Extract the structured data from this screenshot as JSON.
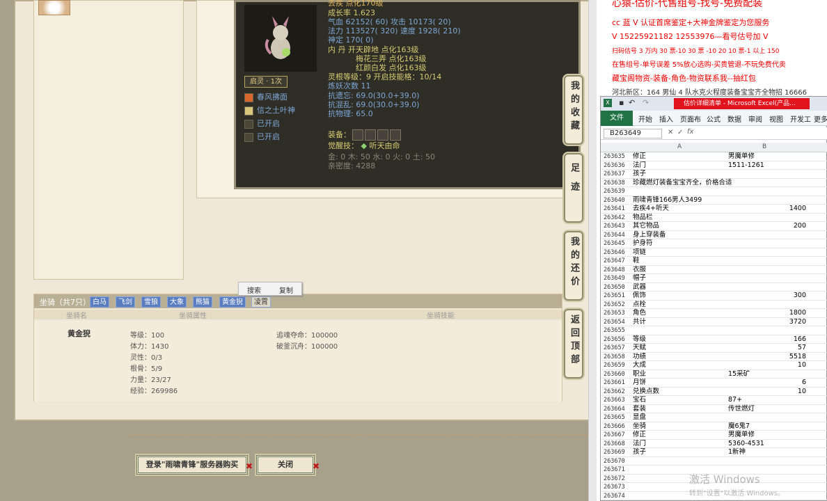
{
  "pet": {
    "line0": "去疾 点化170级",
    "growth": "成长率 1.623",
    "qixue": "气血 62152( 60) 攻击 10173( 20)",
    "fali": "法力 113527( 320) 速度 1928( 210)",
    "shending": "神定 170( 0)",
    "neidan": "内 丹 开天辟地 点化163级",
    "neidan2": "梅花三弄 点化163级",
    "neidan3": "红颜白发 点化163级",
    "linggen": "灵根等级：9 开启技能格：10/14",
    "lianyao": "炼妖次数 11",
    "kangyiwang": "抗遗忘: 69.0(30.0+39.0)",
    "kanghunluan": "抗混乱: 69.0(30.0+39.0)",
    "kangwuli": "抗物理: 65.0",
    "equip_label": "装备：",
    "juexing": "觉醒技：",
    "juexing_skill": "听天由命",
    "wuxing": "金: 0 木: 50 水: 0 火: 0 土: 50",
    "qinmi": "亲密度: 4288",
    "qiling": "启灵 · 1次",
    "skills": [
      "春风拂面",
      "信之土叶神",
      "已开启",
      "已开启"
    ]
  },
  "side_buttons": [
    "我的收藏",
    "足迹",
    "我的还价",
    "返回顶部"
  ],
  "mount": {
    "tab_label": "坐骑（共7只）",
    "tabs": [
      "白马",
      "飞剑",
      "雪狼",
      "大象",
      "熊猫",
      "黄金猊",
      "凌霄"
    ],
    "headers": [
      "坐骑名",
      "坐骑属性",
      "坐骑技能"
    ],
    "name": "黄金猊",
    "stats": [
      "等级：100",
      "体力：1430",
      "灵性：0/3",
      "根骨：5/9",
      "力量：23/27",
      "经验：269986"
    ],
    "skills": [
      "追魂夺命：100000",
      "破釜沉舟：100000"
    ]
  },
  "context_menu": {
    "search": "搜索",
    "copy": "复制"
  },
  "buttons": {
    "login": "登录\"雨啸青锋\"服务器购买",
    "close": "关闭"
  },
  "promo": {
    "l0": "心猿-估价-代售组号-找号-免费配装",
    "l1": "cc 蓝 V 认证首席鉴定+大神金牌鉴定为您服务",
    "l2": "V 15225921182      12553976—看号估号加 V",
    "l3": "扫码估号 3 万内 30 票-10 30 票 -10 20 10 票-1 以上 150",
    "l4": "在售组号-单号误差 5%放心选购-买贵管退-不玩免费代卖",
    "l5": "藏宝阁物资-装备-角色-物资联系我--抽红包",
    "l6": "河北新区：164 男仙 4 队水克火程度装备宝宝齐全物招 16666"
  },
  "excel": {
    "title": "估价详细清单 - Microsoft Excel(产品...",
    "ribbon": [
      "文件",
      "开始",
      "插入",
      "页面布",
      "公式",
      "数据",
      "审阅",
      "视图",
      "开发工",
      "更多"
    ],
    "namebox": "B263649",
    "col_a": "A",
    "col_b": "B",
    "rows": [
      [
        "263635",
        "修正",
        "男魔单修",
        false
      ],
      [
        "263636",
        "法门",
        "1511-1261",
        false
      ],
      [
        "263637",
        "孩子",
        "",
        false
      ],
      [
        "263638",
        "珍藏燃灯装备宝宝齐全，价格合适",
        "",
        false
      ],
      [
        "263639",
        "",
        "",
        false
      ],
      [
        "263640",
        "雨啸青锋166男人3499",
        "",
        false
      ],
      [
        "263641",
        "去疾4+听天",
        "1400",
        true
      ],
      [
        "263642",
        "物品栏",
        "",
        false
      ],
      [
        "263643",
        "其它物品",
        "200",
        true
      ],
      [
        "263644",
        "身上穿装备",
        "",
        false
      ],
      [
        "263645",
        "护身符",
        "",
        false
      ],
      [
        "263646",
        "项链",
        "",
        false
      ],
      [
        "263647",
        "鞋",
        "",
        false
      ],
      [
        "263648",
        "衣服",
        "",
        false
      ],
      [
        "263649",
        "帽子",
        "",
        false
      ],
      [
        "263650",
        "武器",
        "",
        false
      ],
      [
        "263651",
        "佩饰",
        "300",
        true
      ],
      [
        "263652",
        "点栓",
        "",
        false
      ],
      [
        "263653",
        "角色",
        "1800",
        true
      ],
      [
        "263654",
        "共计",
        "3720",
        true
      ],
      [
        "263655",
        "",
        "",
        false
      ],
      [
        "263656",
        "等级",
        "166",
        true
      ],
      [
        "263657",
        "天赋",
        "57",
        true
      ],
      [
        "263658",
        "功绩",
        "5518",
        true
      ],
      [
        "263659",
        "大成",
        "10",
        true
      ],
      [
        "263660",
        "职业",
        "15采矿",
        false
      ],
      [
        "263661",
        "月饼",
        "6",
        true
      ],
      [
        "263662",
        "兑换点数",
        "10",
        true
      ],
      [
        "263663",
        "宝石",
        "87+",
        false
      ],
      [
        "263664",
        "套装",
        "传世燃灯",
        false
      ],
      [
        "263665",
        "显盘",
        "",
        false
      ],
      [
        "263666",
        "坐骑",
        "魔6鬼7",
        false
      ],
      [
        "263667",
        "修正",
        "男魔单修",
        false
      ],
      [
        "263668",
        "法门",
        "5360-4531",
        false
      ],
      [
        "263669",
        "孩子",
        "1新神",
        false
      ],
      [
        "263670",
        "",
        "",
        false
      ],
      [
        "263671",
        "",
        "",
        false
      ],
      [
        "263672",
        "",
        "",
        false
      ],
      [
        "263673",
        "",
        "",
        false
      ],
      [
        "263674",
        "",
        "",
        false
      ]
    ]
  },
  "watermark": {
    "line1": "激活 Windows",
    "line2": "转到\"设置\"以激活 Windows。"
  }
}
